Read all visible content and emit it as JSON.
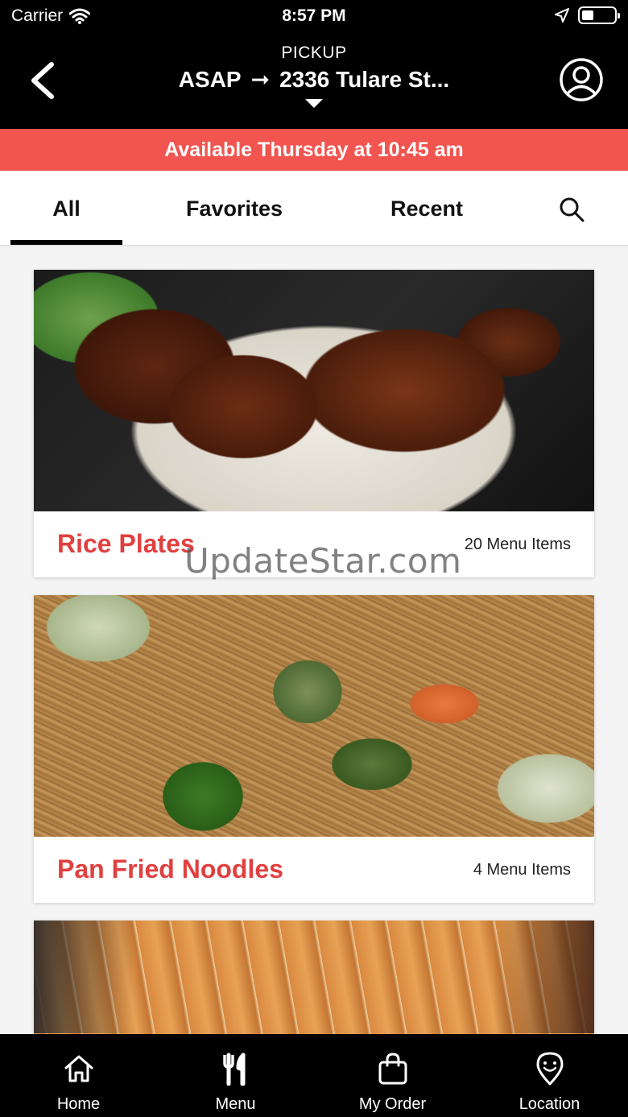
{
  "status": {
    "carrier": "Carrier",
    "time": "8:57 PM"
  },
  "header": {
    "mode": "PICKUP",
    "time_option": "ASAP",
    "arrow": "➞",
    "address": "2336 Tulare St..."
  },
  "banner": {
    "text": "Available Thursday at 10:45 am"
  },
  "tabs": {
    "all": "All",
    "favorites": "Favorites",
    "recent": "Recent"
  },
  "categories": [
    {
      "title": "Rice Plates",
      "count": "20 Menu Items"
    },
    {
      "title": "Pan Fried Noodles",
      "count": "4 Menu Items"
    },
    {
      "title": "",
      "count": ""
    }
  ],
  "watermark": "UpdateStar.com",
  "tabbar": {
    "home": "Home",
    "menu": "Menu",
    "order": "My Order",
    "location": "Location"
  },
  "colors": {
    "accent": "#e0403f",
    "banner": "#f25450",
    "bar": "#000000"
  }
}
